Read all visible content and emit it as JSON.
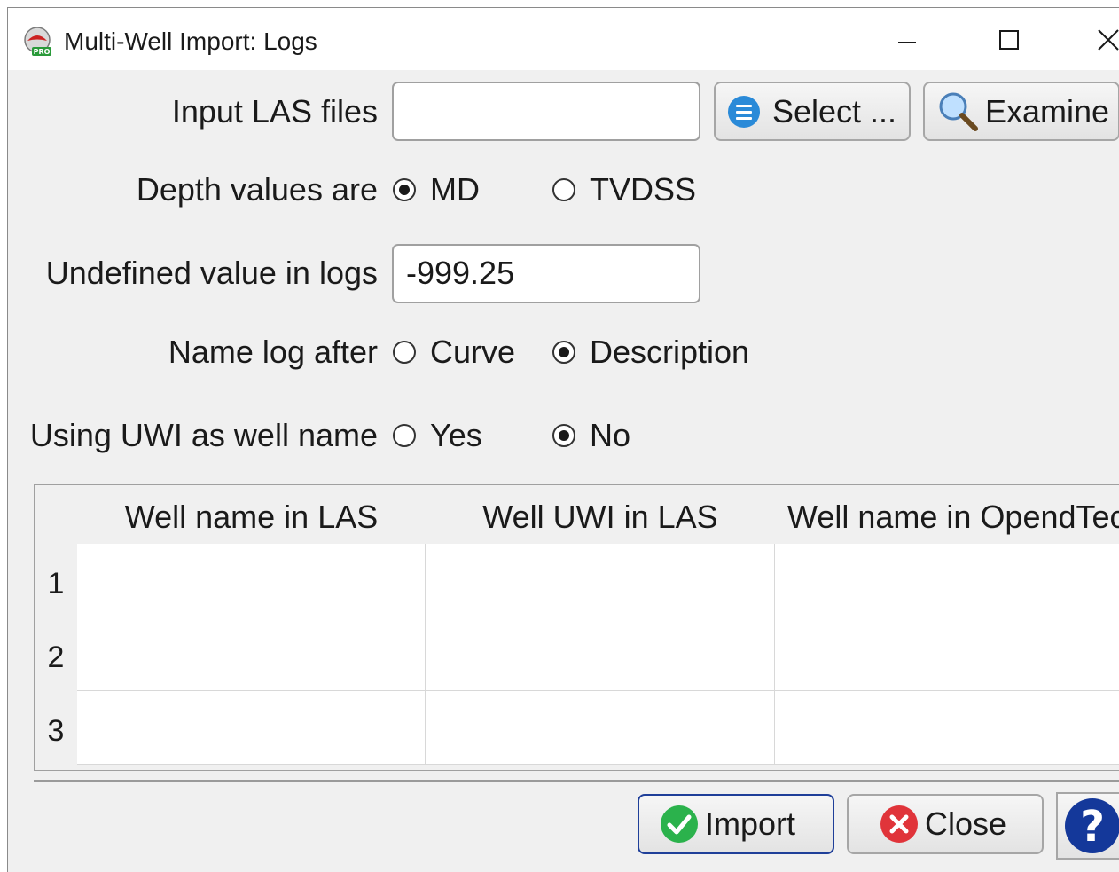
{
  "window": {
    "title": "Multi-Well Import: Logs",
    "controls": [
      "minimize-icon",
      "maximize-icon",
      "close-icon"
    ]
  },
  "input_las": {
    "label": "Input LAS files",
    "value": "",
    "select_label": "Select ...",
    "examine_label": "Examine"
  },
  "depth": {
    "label": "Depth values are",
    "options": [
      "MD",
      "TVDSS"
    ],
    "selected": "MD"
  },
  "undefined": {
    "label": "Undefined value in logs",
    "value": "-999.25"
  },
  "name_log": {
    "label": "Name log after",
    "options": [
      "Curve",
      "Description"
    ],
    "selected": "Description"
  },
  "uwi": {
    "label": "Using UWI as well name",
    "options": [
      "Yes",
      "No"
    ],
    "selected": "No"
  },
  "table": {
    "columns": [
      "Well name in LAS",
      "Well UWI in LAS",
      "Well name in OpendTect"
    ],
    "rows": [
      {
        "num": "1",
        "cells": [
          "",
          "",
          ""
        ]
      },
      {
        "num": "2",
        "cells": [
          "",
          "",
          ""
        ]
      },
      {
        "num": "3",
        "cells": [
          "",
          "",
          ""
        ]
      }
    ]
  },
  "footer": {
    "import_label": "Import",
    "close_label": "Close",
    "help_icon": "help-icon"
  },
  "colors": {
    "accent": "#1f3f99",
    "ok_green": "#2bb24c",
    "cancel_red": "#e0343a",
    "select_blue": "#2a8ad8"
  }
}
